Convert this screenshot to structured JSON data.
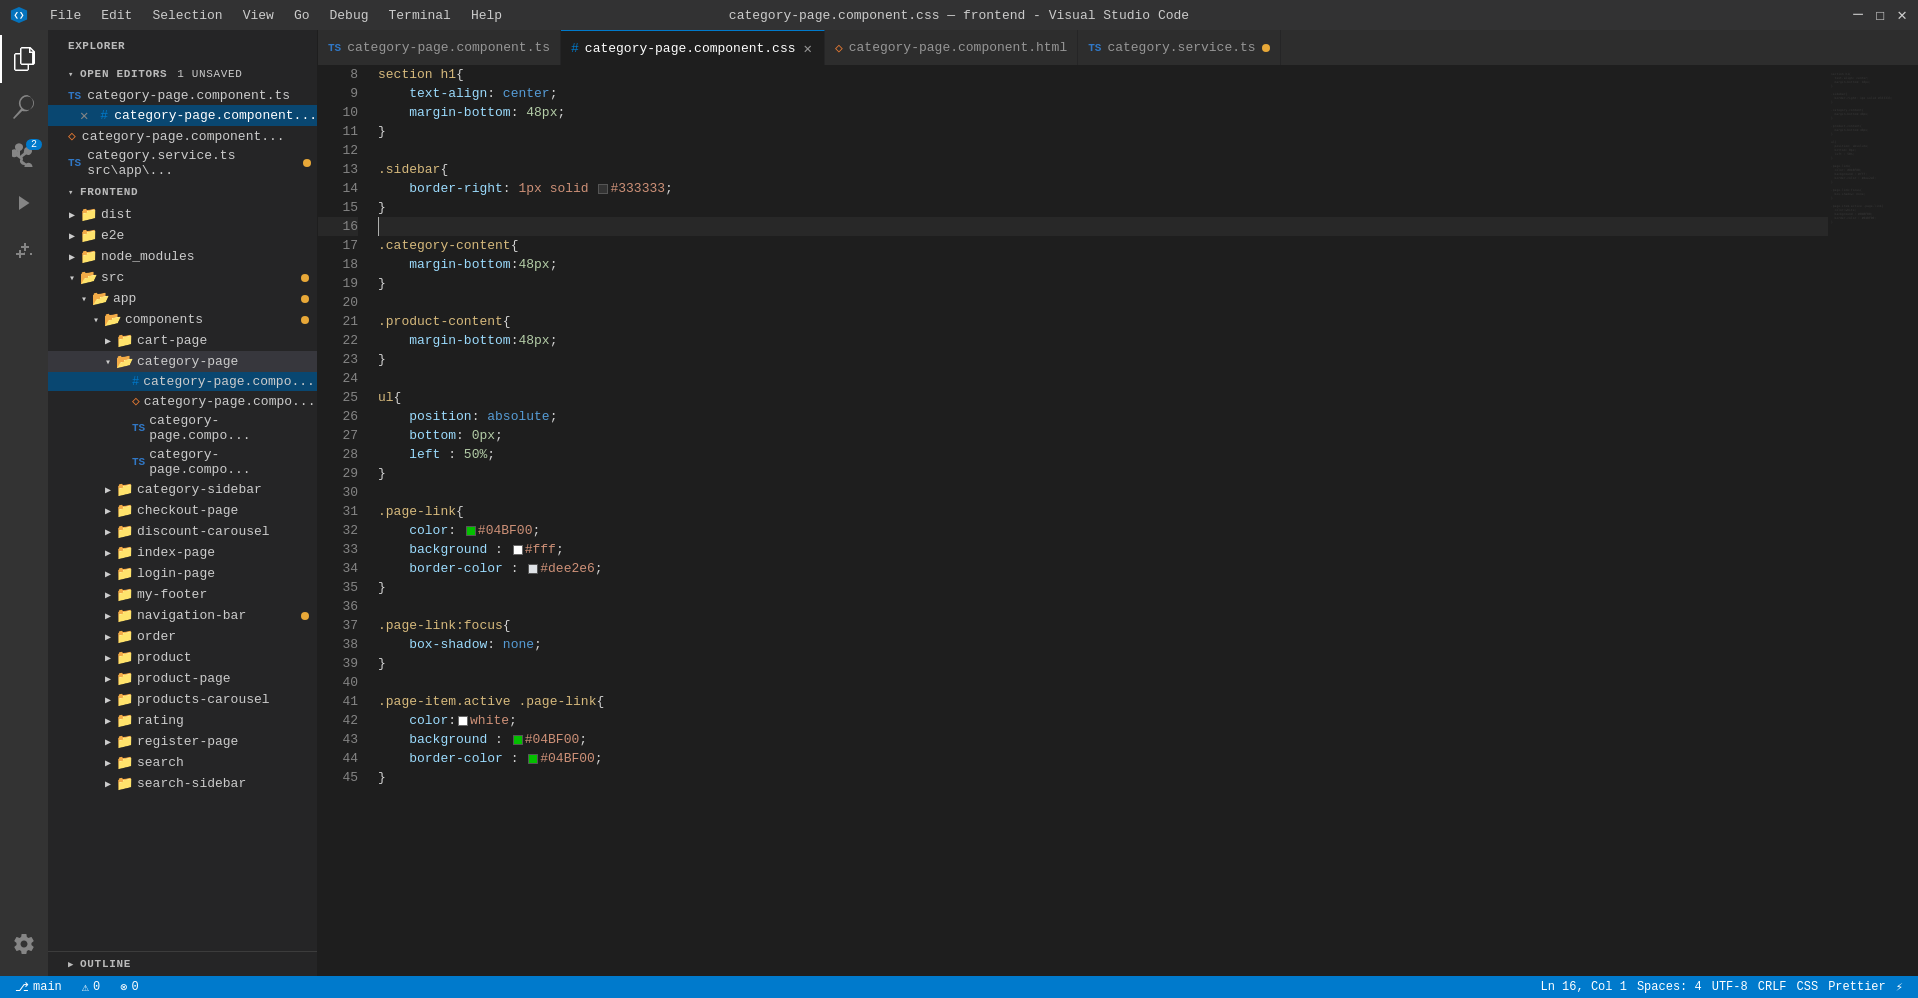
{
  "titlebar": {
    "title": "category-page.component.css — frontend - Visual Studio Code",
    "menu_items": [
      "File",
      "Edit",
      "Selection",
      "View",
      "Go",
      "Debug",
      "Terminal",
      "Help"
    ],
    "controls": [
      "─",
      "☐",
      "✕"
    ]
  },
  "activity_bar": {
    "icons": [
      {
        "name": "explorer",
        "symbol": "⎘",
        "active": true
      },
      {
        "name": "search",
        "symbol": "🔍"
      },
      {
        "name": "source-control",
        "symbol": "⑂",
        "badge": "2"
      },
      {
        "name": "run-debug",
        "symbol": "▷"
      },
      {
        "name": "extensions",
        "symbol": "⊞"
      }
    ],
    "bottom_icons": [
      {
        "name": "settings",
        "symbol": "⚙"
      }
    ]
  },
  "sidebar": {
    "header": "EXPLORER",
    "open_editors": {
      "label": "OPEN EDITORS",
      "badge": "1 UNSAVED",
      "items": [
        {
          "icon": "TS",
          "icon_color": "#3178c6",
          "name": "category-page.component.ts",
          "path": "...",
          "close": true
        },
        {
          "icon": "#",
          "icon_color": "#007acc",
          "name": "category-page.component...",
          "path": "...",
          "modified": true,
          "close": true,
          "active": true
        },
        {
          "icon": "◇",
          "icon_color": "#e37933",
          "name": "category-page.component...",
          "path": "..."
        },
        {
          "icon": "TS",
          "icon_color": "#3178c6",
          "name": "category.service.ts",
          "path": "src\\app\\..."
        }
      ]
    },
    "tree": {
      "root": "FRONTEND",
      "items": [
        {
          "indent": 1,
          "collapsed": true,
          "label": "dist"
        },
        {
          "indent": 1,
          "collapsed": true,
          "label": "e2e"
        },
        {
          "indent": 1,
          "collapsed": true,
          "label": "node_modules"
        },
        {
          "indent": 1,
          "collapsed": false,
          "label": "src",
          "dot": true
        },
        {
          "indent": 2,
          "collapsed": false,
          "label": "app",
          "dot": true
        },
        {
          "indent": 3,
          "collapsed": false,
          "label": "components",
          "dot": true
        },
        {
          "indent": 4,
          "collapsed": true,
          "label": "cart-page"
        },
        {
          "indent": 4,
          "collapsed": false,
          "label": "category-page",
          "selected": true
        },
        {
          "indent": 5,
          "icon": "#",
          "icon_color": "#007acc",
          "label": "category-page.compo...",
          "active": true
        },
        {
          "indent": 5,
          "icon": "◇",
          "icon_color": "#e37933",
          "label": "category-page.compo..."
        },
        {
          "indent": 5,
          "icon": "TS",
          "icon_color": "#3178c6",
          "label": "category-page.compo..."
        },
        {
          "indent": 5,
          "icon": "TS",
          "icon_color": "#3178c6",
          "label": "category-page.compo..."
        },
        {
          "indent": 4,
          "collapsed": true,
          "label": "category-sidebar"
        },
        {
          "indent": 4,
          "collapsed": true,
          "label": "checkout-page"
        },
        {
          "indent": 4,
          "collapsed": true,
          "label": "discount-carousel"
        },
        {
          "indent": 4,
          "collapsed": true,
          "label": "index-page"
        },
        {
          "indent": 4,
          "collapsed": true,
          "label": "login-page"
        },
        {
          "indent": 4,
          "collapsed": true,
          "label": "my-footer"
        },
        {
          "indent": 4,
          "collapsed": true,
          "label": "navigation-bar",
          "dot": true
        },
        {
          "indent": 4,
          "collapsed": true,
          "label": "order"
        },
        {
          "indent": 4,
          "collapsed": true,
          "label": "product"
        },
        {
          "indent": 4,
          "collapsed": true,
          "label": "product-page"
        },
        {
          "indent": 4,
          "collapsed": true,
          "label": "products-carousel"
        },
        {
          "indent": 4,
          "collapsed": true,
          "label": "rating"
        },
        {
          "indent": 4,
          "collapsed": true,
          "label": "register-page"
        },
        {
          "indent": 4,
          "collapsed": true,
          "label": "search"
        },
        {
          "indent": 4,
          "collapsed": true,
          "label": "search-sidebar"
        }
      ]
    },
    "outline": "OUTLINE"
  },
  "tabs": [
    {
      "id": "tab-ts",
      "icon": "TS",
      "icon_color": "#3178c6",
      "label": "category-page.component.ts",
      "active": false
    },
    {
      "id": "tab-css",
      "icon": "#",
      "icon_color": "#007acc",
      "label": "category-page.component.css",
      "active": true,
      "close": true
    },
    {
      "id": "tab-html",
      "icon": "◇",
      "icon_color": "#e37933",
      "label": "category-page.component.html",
      "active": false
    },
    {
      "id": "tab-service",
      "icon": "TS",
      "icon_color": "#3178c6",
      "label": "category.service.ts",
      "active": false,
      "modified": true
    }
  ],
  "code": {
    "lines": [
      {
        "num": 8,
        "tokens": [
          {
            "t": "section h1{",
            "c": "s-selector"
          }
        ]
      },
      {
        "num": 9,
        "tokens": [
          {
            "t": "    text-align",
            "c": "s-property"
          },
          {
            "t": ": ",
            "c": "s-punctuation"
          },
          {
            "t": "center",
            "c": "s-value"
          },
          {
            "t": ";",
            "c": "s-punctuation"
          }
        ]
      },
      {
        "num": 10,
        "tokens": [
          {
            "t": "    margin-bottom",
            "c": "s-property"
          },
          {
            "t": ": ",
            "c": "s-punctuation"
          },
          {
            "t": "48px",
            "c": "s-value-num"
          },
          {
            "t": ";",
            "c": "s-punctuation"
          }
        ]
      },
      {
        "num": 11,
        "tokens": [
          {
            "t": "}",
            "c": "s-punctuation"
          }
        ]
      },
      {
        "num": 12,
        "tokens": []
      },
      {
        "num": 13,
        "tokens": [
          {
            "t": ".sidebar",
            "c": "s-class"
          },
          {
            "t": "{",
            "c": "s-punctuation"
          }
        ]
      },
      {
        "num": 14,
        "tokens": [
          {
            "t": "    border-right",
            "c": "s-property"
          },
          {
            "t": ": ",
            "c": "s-punctuation"
          },
          {
            "t": "1px solid ",
            "c": "s-value"
          },
          {
            "t": "SWATCH:#333333",
            "c": "swatch"
          },
          {
            "t": "#333333",
            "c": "s-value"
          },
          {
            "t": ";",
            "c": "s-punctuation"
          }
        ]
      },
      {
        "num": 15,
        "tokens": [
          {
            "t": "}",
            "c": "s-punctuation"
          }
        ]
      },
      {
        "num": 16,
        "tokens": [
          {
            "t": "",
            "c": "cursor"
          }
        ],
        "cursor": true
      },
      {
        "num": 17,
        "tokens": [
          {
            "t": ".category-content",
            "c": "s-class"
          },
          {
            "t": "{",
            "c": "s-punctuation"
          }
        ]
      },
      {
        "num": 18,
        "tokens": [
          {
            "t": "    margin-bottom",
            "c": "s-property"
          },
          {
            "t": ":",
            "c": "s-punctuation"
          },
          {
            "t": "48px",
            "c": "s-value-num"
          },
          {
            "t": ";",
            "c": "s-punctuation"
          }
        ]
      },
      {
        "num": 19,
        "tokens": [
          {
            "t": "}",
            "c": "s-punctuation"
          }
        ]
      },
      {
        "num": 20,
        "tokens": []
      },
      {
        "num": 21,
        "tokens": [
          {
            "t": ".product-content",
            "c": "s-class"
          },
          {
            "t": "{",
            "c": "s-punctuation"
          }
        ]
      },
      {
        "num": 22,
        "tokens": [
          {
            "t": "    margin-bottom",
            "c": "s-property"
          },
          {
            "t": ":",
            "c": "s-punctuation"
          },
          {
            "t": "48px",
            "c": "s-value-num"
          },
          {
            "t": ";",
            "c": "s-punctuation"
          }
        ]
      },
      {
        "num": 23,
        "tokens": [
          {
            "t": "}",
            "c": "s-punctuation"
          }
        ]
      },
      {
        "num": 24,
        "tokens": []
      },
      {
        "num": 25,
        "tokens": [
          {
            "t": "ul",
            "c": "s-selector"
          },
          {
            "t": "{",
            "c": "s-punctuation"
          }
        ]
      },
      {
        "num": 26,
        "tokens": [
          {
            "t": "    position",
            "c": "s-property"
          },
          {
            "t": ": ",
            "c": "s-punctuation"
          },
          {
            "t": "absolute",
            "c": "s-value-keyword"
          },
          {
            "t": ";",
            "c": "s-punctuation"
          }
        ]
      },
      {
        "num": 27,
        "tokens": [
          {
            "t": "    bottom",
            "c": "s-property"
          },
          {
            "t": ": ",
            "c": "s-punctuation"
          },
          {
            "t": "0px",
            "c": "s-value-num"
          },
          {
            "t": ";",
            "c": "s-punctuation"
          }
        ]
      },
      {
        "num": 28,
        "tokens": [
          {
            "t": "    left ",
            "c": "s-property"
          },
          {
            "t": ": ",
            "c": "s-punctuation"
          },
          {
            "t": "50%",
            "c": "s-value-num"
          },
          {
            "t": ";",
            "c": "s-punctuation"
          }
        ]
      },
      {
        "num": 29,
        "tokens": [
          {
            "t": "}",
            "c": "s-punctuation"
          }
        ]
      },
      {
        "num": 30,
        "tokens": []
      },
      {
        "num": 31,
        "tokens": [
          {
            "t": ".page-link",
            "c": "s-class"
          },
          {
            "t": "{",
            "c": "s-punctuation"
          }
        ]
      },
      {
        "num": 32,
        "tokens": [
          {
            "t": "    color",
            "c": "s-property"
          },
          {
            "t": ": ",
            "c": "s-punctuation"
          },
          {
            "t": "SWATCH:#04BF00",
            "c": "swatch"
          },
          {
            "t": "#04BF00",
            "c": "s-value"
          },
          {
            "t": ";",
            "c": "s-punctuation"
          }
        ]
      },
      {
        "num": 33,
        "tokens": [
          {
            "t": "    background ",
            "c": "s-property"
          },
          {
            "t": ": ",
            "c": "s-punctuation"
          },
          {
            "t": "SWATCH:#ffffff",
            "c": "swatch"
          },
          {
            "t": "#fff",
            "c": "s-value"
          },
          {
            "t": ";",
            "c": "s-punctuation"
          }
        ]
      },
      {
        "num": 34,
        "tokens": [
          {
            "t": "    border-color ",
            "c": "s-property"
          },
          {
            "t": ": ",
            "c": "s-punctuation"
          },
          {
            "t": "SWATCH:#dee2e6",
            "c": "swatch"
          },
          {
            "t": "#dee2e6",
            "c": "s-value"
          },
          {
            "t": ";",
            "c": "s-punctuation"
          }
        ]
      },
      {
        "num": 35,
        "tokens": [
          {
            "t": "}",
            "c": "s-punctuation"
          }
        ]
      },
      {
        "num": 36,
        "tokens": []
      },
      {
        "num": 37,
        "tokens": [
          {
            "t": ".page-link:focus",
            "c": "s-class"
          },
          {
            "t": "{",
            "c": "s-punctuation"
          }
        ]
      },
      {
        "num": 38,
        "tokens": [
          {
            "t": "    box-shadow",
            "c": "s-property"
          },
          {
            "t": ": ",
            "c": "s-punctuation"
          },
          {
            "t": "none",
            "c": "s-value-keyword"
          },
          {
            "t": ";",
            "c": "s-punctuation"
          }
        ]
      },
      {
        "num": 39,
        "tokens": [
          {
            "t": "}",
            "c": "s-punctuation"
          }
        ]
      },
      {
        "num": 40,
        "tokens": []
      },
      {
        "num": 41,
        "tokens": [
          {
            "t": ".page-item.active .page-link",
            "c": "s-class"
          },
          {
            "t": "{",
            "c": "s-punctuation"
          }
        ]
      },
      {
        "num": 42,
        "tokens": [
          {
            "t": "    color",
            "c": "s-property"
          },
          {
            "t": ":",
            "c": "s-punctuation"
          },
          {
            "t": "SWATCH:#ffffff",
            "c": "swatch"
          },
          {
            "t": "white",
            "c": "s-value"
          },
          {
            "t": ";",
            "c": "s-punctuation"
          }
        ]
      },
      {
        "num": 43,
        "tokens": [
          {
            "t": "    background ",
            "c": "s-property"
          },
          {
            "t": ": ",
            "c": "s-punctuation"
          },
          {
            "t": "SWATCH:#04BF00",
            "c": "swatch"
          },
          {
            "t": "#04BF00",
            "c": "s-value"
          },
          {
            "t": ";",
            "c": "s-punctuation"
          }
        ]
      },
      {
        "num": 44,
        "tokens": [
          {
            "t": "    border-color ",
            "c": "s-property"
          },
          {
            "t": ": ",
            "c": "s-punctuation"
          },
          {
            "t": "SWATCH:#04BF00",
            "c": "swatch"
          },
          {
            "t": "#04BF00",
            "c": "s-value"
          },
          {
            "t": ";",
            "c": "s-punctuation"
          }
        ]
      },
      {
        "num": 45,
        "tokens": [
          {
            "t": "}",
            "c": "s-punctuation"
          }
        ]
      }
    ]
  },
  "status_bar": {
    "left": [
      {
        "label": "⎇ main"
      },
      {
        "label": "⚠ 0"
      },
      {
        "label": "⊗ 0"
      }
    ],
    "right": [
      {
        "label": "Ln 16, Col 1"
      },
      {
        "label": "Spaces: 4"
      },
      {
        "label": "UTF-8"
      },
      {
        "label": "CRLF"
      },
      {
        "label": "CSS"
      },
      {
        "label": "Prettier"
      },
      {
        "label": "⚡"
      }
    ]
  }
}
